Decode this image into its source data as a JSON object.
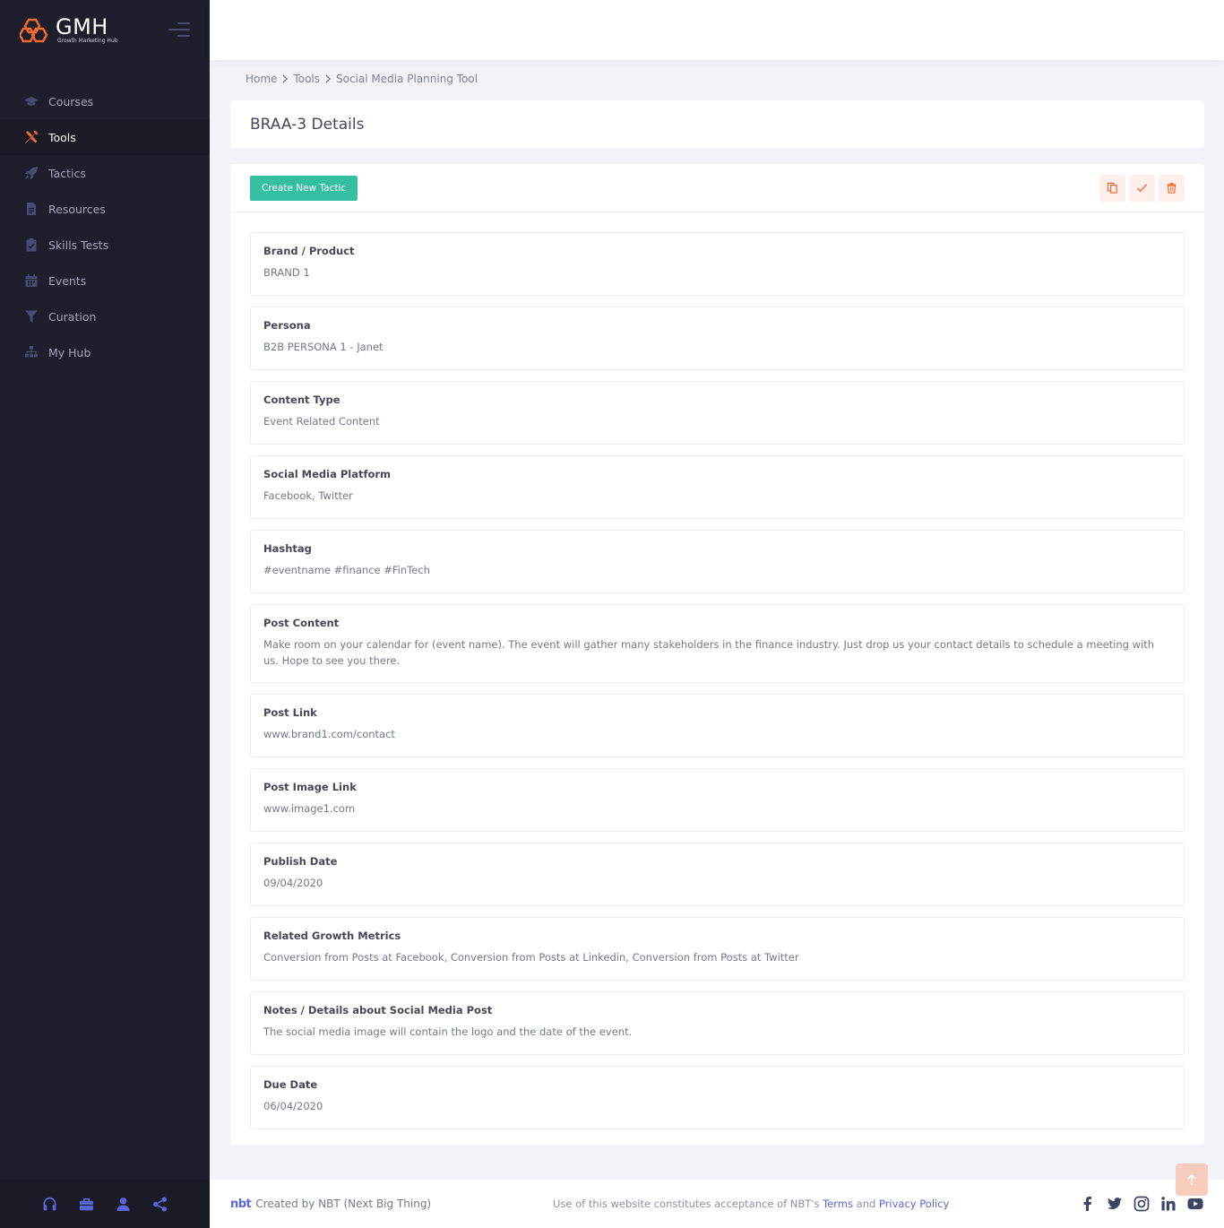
{
  "brand": {
    "name": "GMH",
    "tagline": "Growth Marketing Hub"
  },
  "sidebar": {
    "items": [
      {
        "label": "Courses",
        "icon": "graduation-cap-icon",
        "active": false
      },
      {
        "label": "Tools",
        "icon": "tools-icon",
        "active": true
      },
      {
        "label": "Tactics",
        "icon": "rocket-icon",
        "active": false
      },
      {
        "label": "Resources",
        "icon": "document-icon",
        "active": false
      },
      {
        "label": "Skills Tests",
        "icon": "clipboard-check-icon",
        "active": false
      },
      {
        "label": "Events",
        "icon": "calendar-icon",
        "active": false
      },
      {
        "label": "Curation",
        "icon": "filter-icon",
        "active": false
      },
      {
        "label": "My Hub",
        "icon": "sitemap-icon",
        "active": false
      }
    ],
    "footer_icons": [
      "headset-icon",
      "briefcase-icon",
      "user-icon",
      "share-icon"
    ]
  },
  "breadcrumb": {
    "home": "Home",
    "tools": "Tools",
    "current": "Social Media Planning Tool"
  },
  "page": {
    "title": "BRAA-3 Details",
    "create_button": "Create New Tactic"
  },
  "fields": [
    {
      "label": "Brand / Product",
      "value": "BRAND 1"
    },
    {
      "label": "Persona",
      "value": "B2B PERSONA 1 - Janet"
    },
    {
      "label": "Content Type",
      "value": "Event Related Content"
    },
    {
      "label": "Social Media Platform",
      "value": "Facebook, Twitter"
    },
    {
      "label": "Hashtag",
      "value": "#eventname #finance #FinTech"
    },
    {
      "label": "Post Content",
      "value": "Make room on your calendar for (event name). The event will gather many stakeholders in the finance industry. Just drop us your contact details to schedule a meeting with us. Hope to see you there."
    },
    {
      "label": "Post Link",
      "value": "www.brand1.com/contact"
    },
    {
      "label": "Post Image Link",
      "value": "www.image1.com"
    },
    {
      "label": "Publish Date",
      "value": "09/04/2020"
    },
    {
      "label": "Related Growth Metrics",
      "value": "Conversion from Posts at Facebook, Conversion from Posts at Linkedin, Conversion from Posts at Twitter"
    },
    {
      "label": "Notes / Details about Social Media Post",
      "value": "The social media image will contain the logo and the date of the event."
    },
    {
      "label": "Due Date",
      "value": "06/04/2020"
    }
  ],
  "footer": {
    "logo": "nbt",
    "created_by": "Created by",
    "company": "NBT (Next Big Thing)",
    "notice": "Use of this website constitutes acceptance of NBT's",
    "terms": "Terms",
    "and": "and",
    "privacy": "Privacy Policy"
  },
  "colors": {
    "sidebar_bg": "#1e1e2d",
    "accent_orange": "#f26a2f",
    "create_button": "#34bfa3",
    "link": "#5867dd"
  }
}
